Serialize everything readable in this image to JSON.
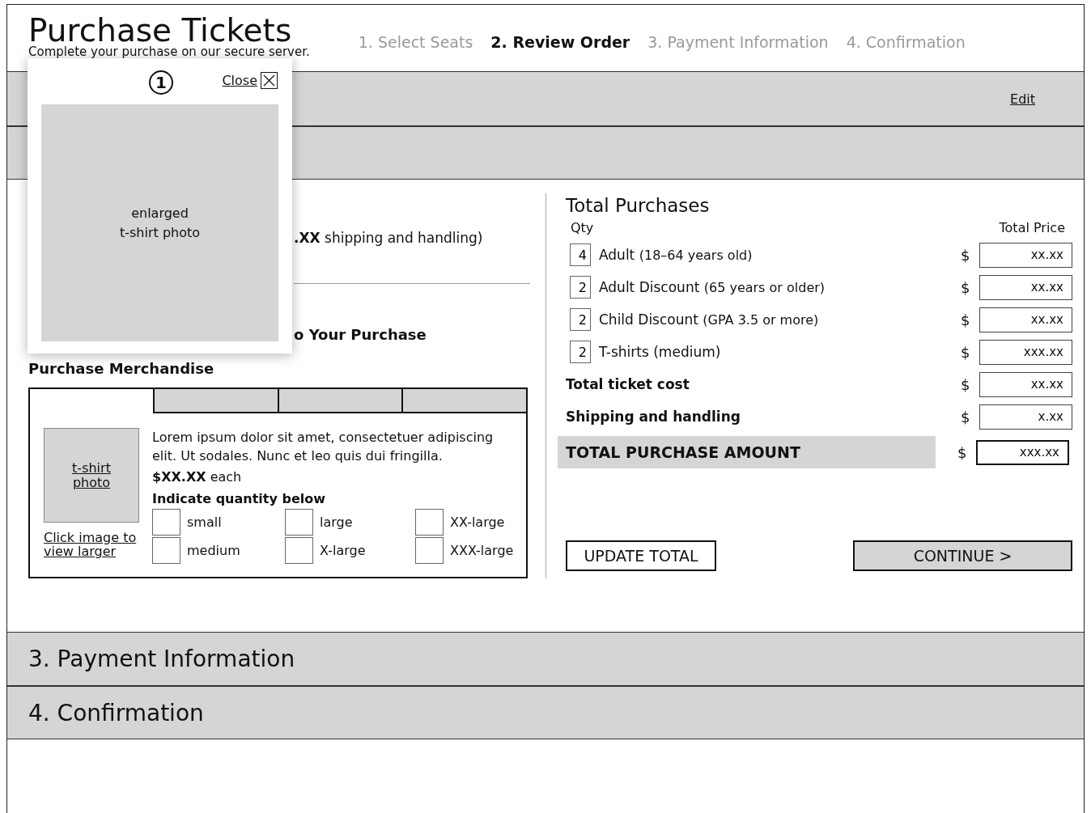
{
  "header": {
    "title": "Purchase Tickets",
    "subtitle": "Complete your purchase on our secure server."
  },
  "steps": [
    {
      "label": "1. Select Seats",
      "selected": false
    },
    {
      "label": "2. Review Order",
      "selected": true
    },
    {
      "label": "3. Payment Information",
      "selected": false
    },
    {
      "label": "4. Confirmation",
      "selected": false
    }
  ],
  "section_one": {
    "link": "Edit"
  },
  "shipping_option": "**.XX** shipping and handling)",
  "add_on_heading": "o Your Purchase",
  "merchandise": {
    "heading": "Purchase Merchandise",
    "photo_label": "t-shirt photo",
    "photo_link": "Click image to view larger",
    "description": "Lorem ipsum dolor sit amet, consectetuer adipiscing elit. Ut sodales. Nunc et leo quis dui fringilla.",
    "price": "**$XX.XX** each",
    "quantity_heading": "Indicate quantity below",
    "sizes": [
      {
        "label": "small"
      },
      {
        "label": "medium"
      },
      {
        "label": "large"
      },
      {
        "label": "X-large"
      },
      {
        "label": "XX-large"
      },
      {
        "label": "XXX-large"
      }
    ]
  },
  "totals": {
    "title": "Total Purchases",
    "qty_header": "Qty",
    "price_header": "Total Price",
    "items": [
      {
        "qty": "4",
        "label": "Adult",
        "note": "(18–64 years old)",
        "currency": "$",
        "price": "xx.xx"
      },
      {
        "qty": "2",
        "label": "Adult Discount",
        "note": "(65 years or older)",
        "currency": "$",
        "price": "xx.xx"
      },
      {
        "qty": "2",
        "label": "Child Discount",
        "note": "(GPA 3.5 or more)",
        "currency": "$",
        "price": "xx.xx"
      },
      {
        "qty": "2",
        "label": "T-shirts (medium)",
        "currency": "$",
        "price": "xxx.xx"
      }
    ],
    "summary": [
      {
        "kind": "subtotal",
        "label": "Total ticket cost",
        "currency": "$",
        "price": "xx.xx"
      },
      {
        "kind": "subtotal",
        "label": "Shipping and handling",
        "currency": "$",
        "price": "x.xx"
      },
      {
        "kind": "grand",
        "label": "TOTAL PURCHASE AMOUNT",
        "currency": "$",
        "price": "xxx.xx"
      }
    ],
    "buttons": [
      {
        "kind": "secondary",
        "label": "UPDATE TOTAL"
      },
      {
        "kind": "primary",
        "label": "CONTINUE >"
      }
    ]
  },
  "lower_sections": [
    "3. Payment Information",
    "4. Confirmation"
  ],
  "popup": {
    "badge": "1",
    "close": "Close",
    "caption": [
      "enlarged",
      "t-shirt photo"
    ]
  }
}
